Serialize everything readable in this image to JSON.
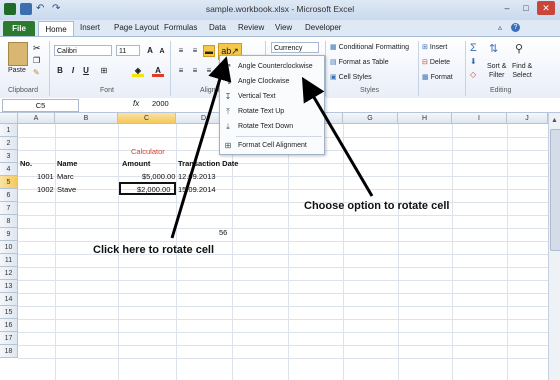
{
  "window": {
    "title": "sample.workbook.xlsx - Microsoft Excel"
  },
  "tabs": {
    "file": "File",
    "home": "Home",
    "insert": "Insert",
    "page_layout": "Page Layout",
    "formulas": "Formulas",
    "data": "Data",
    "review": "Review",
    "view": "View",
    "developer": "Developer"
  },
  "ribbon": {
    "paste": "Paste",
    "font_name": "Calibri",
    "font_size": "11",
    "number_format": "Currency",
    "conditional_formatting": "Conditional Formatting",
    "format_as_table": "Format as Table",
    "cell_styles": "Cell Styles",
    "insert": "Insert",
    "delete": "Delete",
    "format": "Format",
    "sort_filter_1": "Sort &",
    "sort_filter_2": "Filter",
    "find_select_1": "Find &",
    "find_select_2": "Select",
    "groups": {
      "clipboard": "Clipboard",
      "font": "Font",
      "alignment": "Alignm",
      "styles": "Styles",
      "editing": "Editing"
    }
  },
  "formula_bar": {
    "name_box": "C5",
    "fx": "fx",
    "value": "2000"
  },
  "columns": [
    "A",
    "B",
    "C",
    "D",
    "E",
    "F",
    "G",
    "H",
    "I",
    "J",
    "K",
    "L"
  ],
  "rows": [
    "1",
    "2",
    "3",
    "4",
    "5",
    "6",
    "7",
    "8",
    "9",
    "10",
    "11",
    "12",
    "13",
    "14",
    "15",
    "16",
    "17",
    "18"
  ],
  "cells": {
    "c2": "Calculator",
    "a3": "No.",
    "b3": "Name",
    "c3": "Amount",
    "d3": "Transaction Date",
    "a4": "1001",
    "b4": "Marc",
    "c4": "$5,000.00",
    "d4": "12.09.2013",
    "a5": "1002",
    "b5": "Stave",
    "c5": "$2,000.00",
    "d5": "15.09.2014",
    "d8": "56"
  },
  "dropdown": {
    "items": [
      {
        "label": "Angle Counterclockwise",
        "icon": "angle-ccw-icon"
      },
      {
        "label": "Angle Clockwise",
        "icon": "angle-cw-icon"
      },
      {
        "label": "Vertical Text",
        "icon": "vertical-text-icon"
      },
      {
        "label": "Rotate Text Up",
        "icon": "rotate-up-icon"
      },
      {
        "label": "Rotate Text Down",
        "icon": "rotate-down-icon"
      },
      {
        "label": "Format Cell Alignment",
        "icon": "format-alignment-icon"
      }
    ]
  },
  "annotations": {
    "click_here": "Click here to rotate cell",
    "choose_option": "Choose option to rotate cell"
  },
  "colors": {
    "file_tab": "#2b7a2f",
    "calculator_text": "#e03a2a",
    "highlight": "#f5c84a"
  }
}
